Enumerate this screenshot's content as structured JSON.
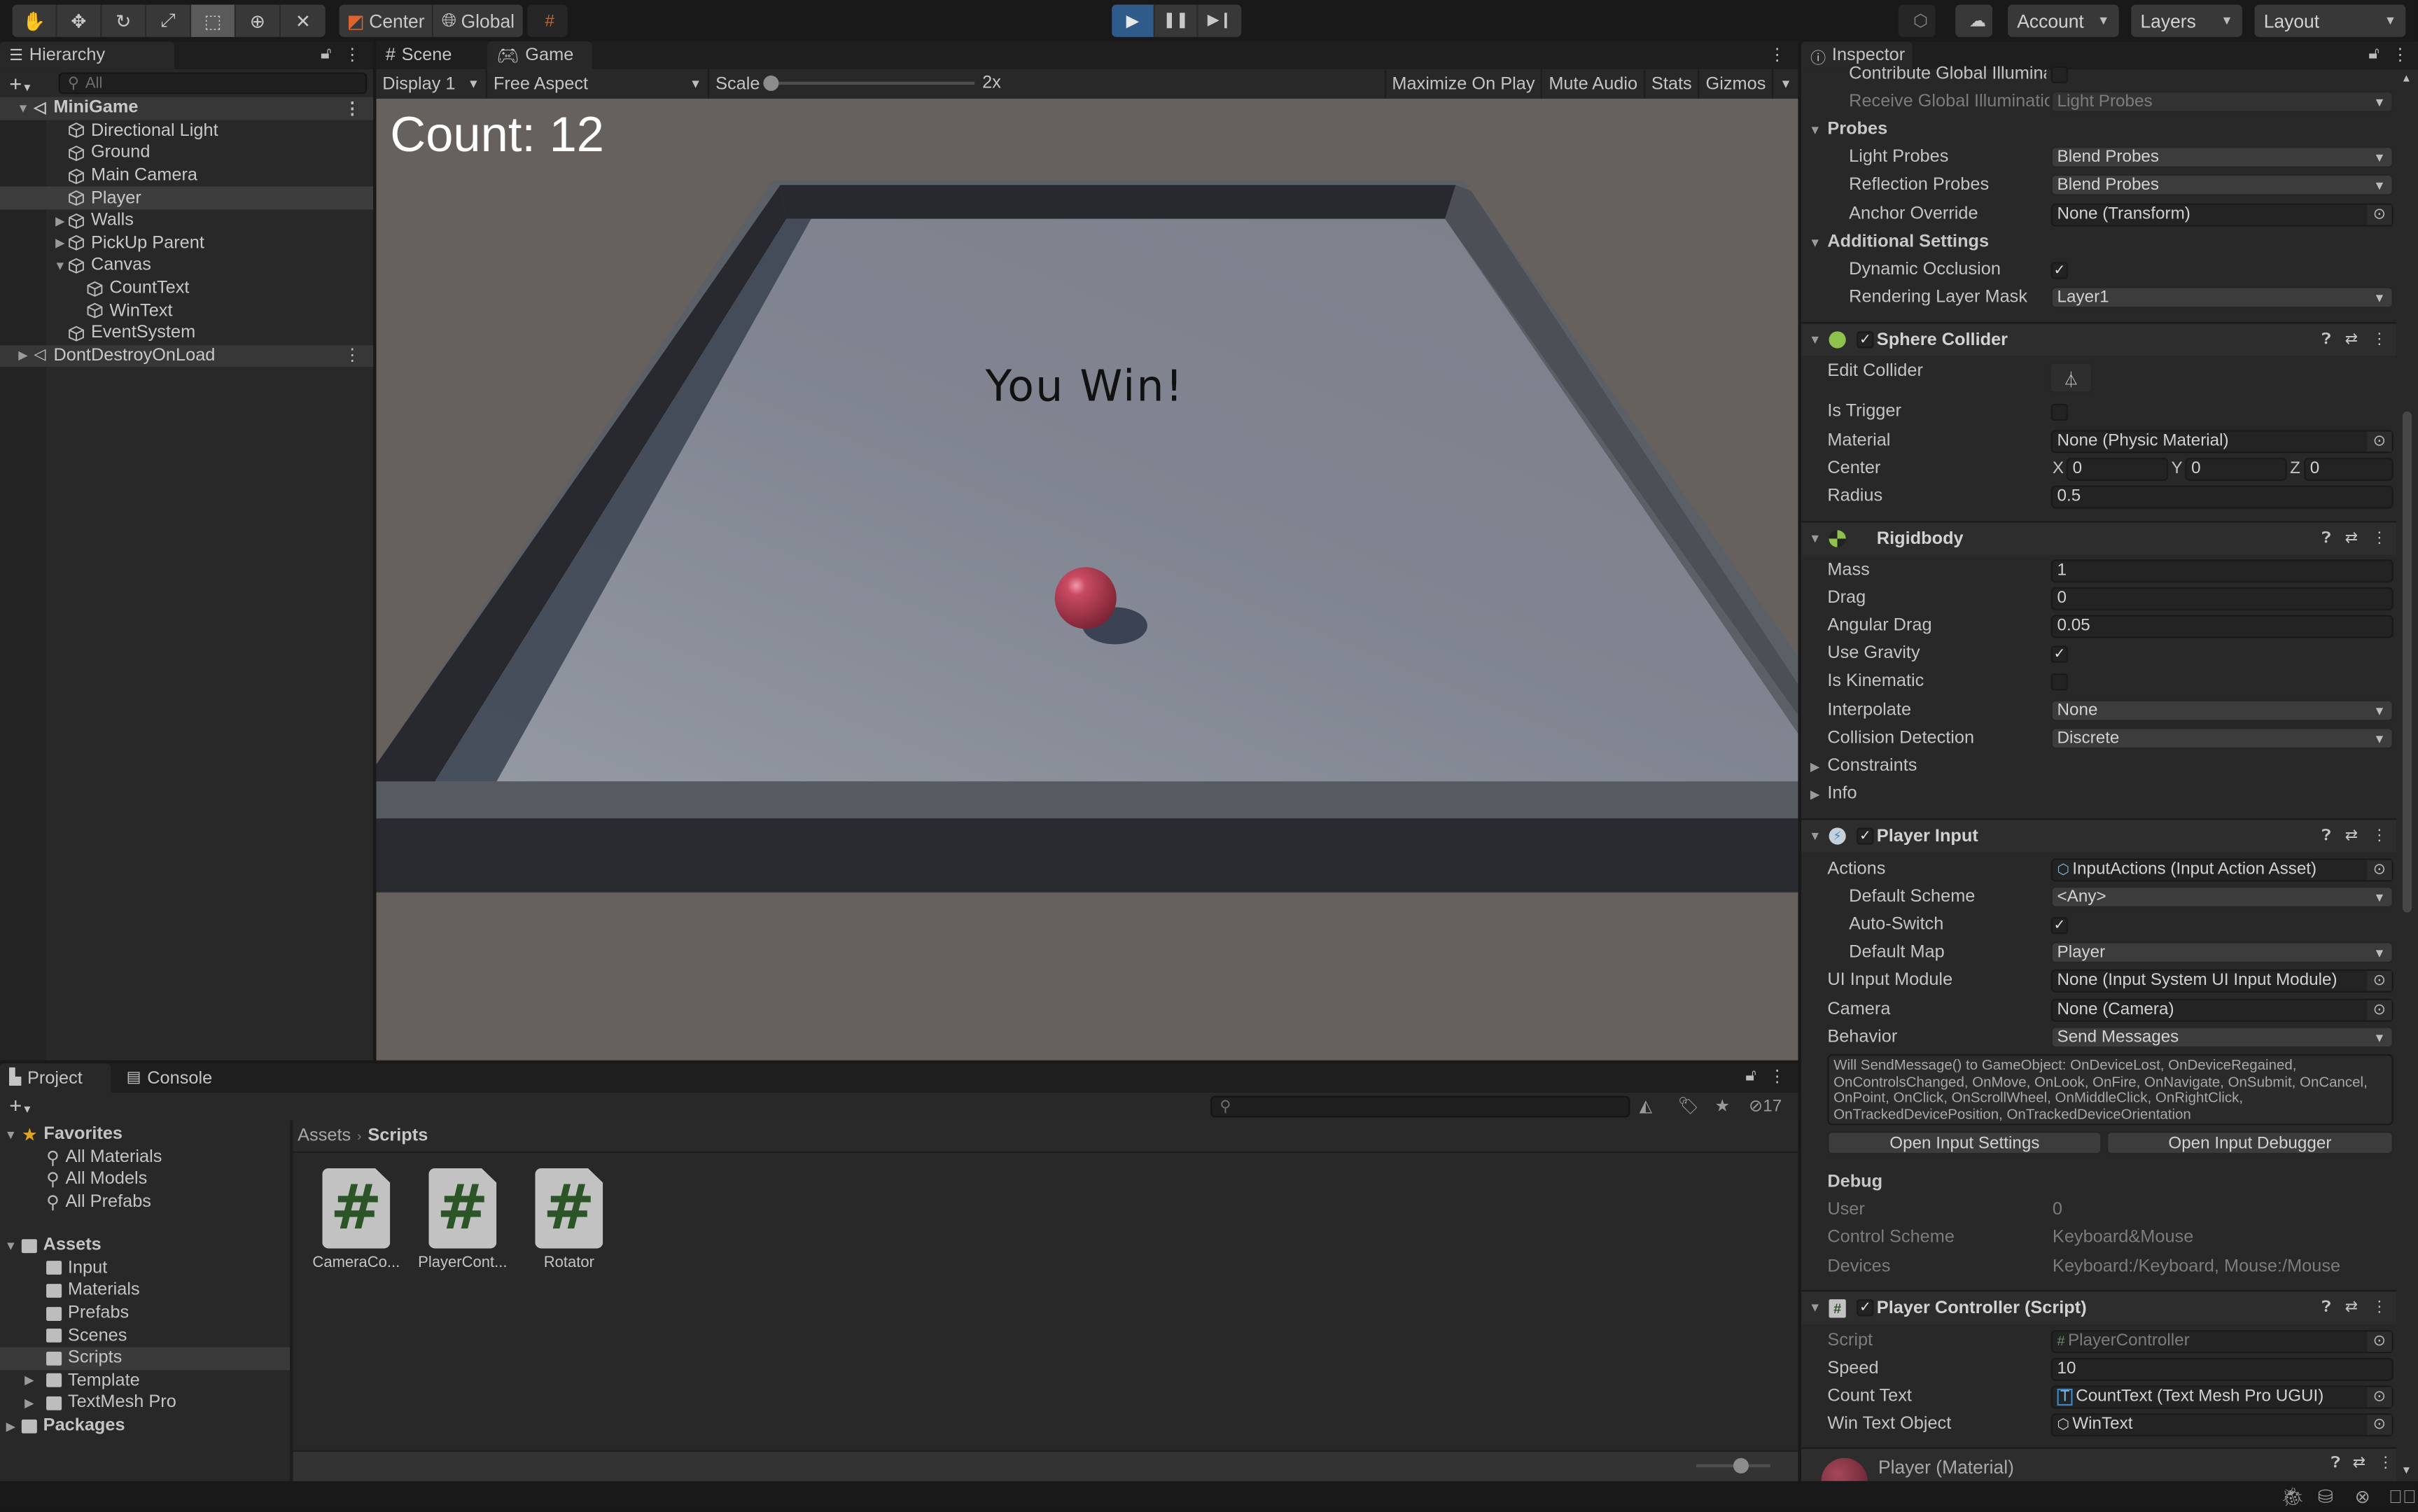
{
  "toolbar": {
    "tools": [
      "hand-tool",
      "move-tool",
      "rotate-tool",
      "scale-tool",
      "rect-tool",
      "transform-tool",
      "custom-tool"
    ],
    "active_tool": "rect-tool",
    "pivot_label": "Center",
    "space_label": "Global",
    "play_state": "playing",
    "account_label": "Account",
    "layers_label": "Layers",
    "layout_label": "Layout"
  },
  "hierarchy": {
    "tab_label": "Hierarchy",
    "search_placeholder": "All",
    "items": [
      {
        "label": "MiniGame",
        "type": "scene",
        "expanded": true
      },
      {
        "label": "Directional Light",
        "type": "object"
      },
      {
        "label": "Ground",
        "type": "object"
      },
      {
        "label": "Main Camera",
        "type": "object"
      },
      {
        "label": "Player",
        "type": "object",
        "selected": true
      },
      {
        "label": "Walls",
        "type": "object",
        "collapsed": true
      },
      {
        "label": "PickUp Parent",
        "type": "object",
        "collapsed": true
      },
      {
        "label": "Canvas",
        "type": "object",
        "expanded": true
      },
      {
        "label": "CountText",
        "type": "object"
      },
      {
        "label": "WinText",
        "type": "object"
      },
      {
        "label": "EventSystem",
        "type": "object"
      },
      {
        "label": "DontDestroyOnLoad",
        "type": "scene",
        "collapsed": true
      }
    ]
  },
  "game_view": {
    "tabs": [
      {
        "label": "Scene"
      },
      {
        "label": "Game",
        "active": true
      }
    ],
    "display": "Display 1",
    "aspect": "Free Aspect",
    "scale_label": "Scale",
    "scale_value": "2x",
    "maximize_on_play": "Maximize On Play",
    "mute_audio": "Mute Audio",
    "stats": "Stats",
    "gizmos": "Gizmos",
    "count_text": "Count: 12",
    "win_text": "You Win!"
  },
  "inspector": {
    "tab_label": "Inspector",
    "mesh_renderer": {
      "contribute_gi_label": "Contribute Global Illumina",
      "receive_gi_label": "Receive Global Illuminatio",
      "receive_gi_value": "Light Probes",
      "probes_header": "Probes",
      "light_probes_label": "Light Probes",
      "light_probes_value": "Blend Probes",
      "reflection_probes_label": "Reflection Probes",
      "reflection_probes_value": "Blend Probes",
      "anchor_override_label": "Anchor Override",
      "anchor_override_value": "None (Transform)",
      "additional_header": "Additional Settings",
      "dynamic_occlusion_label": "Dynamic Occlusion",
      "rendering_layer_mask_label": "Rendering Layer Mask",
      "rendering_layer_mask_value": "Layer1"
    },
    "sphere_collider": {
      "title": "Sphere Collider",
      "edit_collider_label": "Edit Collider",
      "is_trigger_label": "Is Trigger",
      "material_label": "Material",
      "material_value": "None (Physic Material)",
      "center_label": "Center",
      "center_x": "0",
      "center_y": "0",
      "center_z": "0",
      "radius_label": "Radius",
      "radius_value": "0.5"
    },
    "rigidbody": {
      "title": "Rigidbody",
      "mass_label": "Mass",
      "mass_value": "1",
      "drag_label": "Drag",
      "drag_value": "0",
      "angular_drag_label": "Angular Drag",
      "angular_drag_value": "0.05",
      "use_gravity_label": "Use Gravity",
      "is_kinematic_label": "Is Kinematic",
      "interpolate_label": "Interpolate",
      "interpolate_value": "None",
      "collision_label": "Collision Detection",
      "collision_value": "Discrete",
      "constraints_label": "Constraints",
      "info_label": "Info"
    },
    "player_input": {
      "title": "Player Input",
      "actions_label": "Actions",
      "actions_value": "InputActions (Input Action Asset)",
      "default_scheme_label": "Default Scheme",
      "default_scheme_value": "<Any>",
      "auto_switch_label": "Auto-Switch",
      "default_map_label": "Default Map",
      "default_map_value": "Player",
      "ui_input_label": "UI Input Module",
      "ui_input_value": "None (Input System UI Input Module)",
      "camera_label": "Camera",
      "camera_value": "None (Camera)",
      "behavior_label": "Behavior",
      "behavior_value": "Send Messages",
      "help_text": "Will SendMessage() to GameObject: OnDeviceLost, OnDeviceRegained, OnControlsChanged, OnMove, OnLook, OnFire, OnNavigate, OnSubmit, OnCancel, OnPoint, OnClick, OnScrollWheel, OnMiddleClick, OnRightClick, OnTrackedDevicePosition, OnTrackedDeviceOrientation",
      "open_settings": "Open Input Settings",
      "open_debugger": "Open Input Debugger",
      "debug_header": "Debug",
      "user_label": "User",
      "user_value": "0",
      "control_scheme_label": "Control Scheme",
      "control_scheme_value": "Keyboard&Mouse",
      "devices_label": "Devices",
      "devices_value": "Keyboard:/Keyboard, Mouse:/Mouse"
    },
    "player_controller": {
      "title": "Player Controller (Script)",
      "script_label": "Script",
      "script_value": "PlayerController",
      "speed_label": "Speed",
      "speed_value": "10",
      "count_text_label": "Count Text",
      "count_text_value": "CountText (Text Mesh Pro UGUI)",
      "win_text_label": "Win Text Object",
      "win_text_value": "WinText"
    },
    "material": {
      "title": "Player (Material)"
    }
  },
  "project": {
    "tabs": [
      {
        "label": "Project",
        "active": true
      },
      {
        "label": "Console"
      }
    ],
    "hidden_count": "17",
    "breadcrumb": [
      "Assets",
      "Scripts"
    ],
    "tree": [
      {
        "label": "Favorites",
        "kind": "header-star"
      },
      {
        "label": "All Materials",
        "kind": "search"
      },
      {
        "label": "All Models",
        "kind": "search"
      },
      {
        "label": "All Prefabs",
        "kind": "search"
      },
      {
        "label": "Assets",
        "kind": "header-folder"
      },
      {
        "label": "Input",
        "kind": "folder"
      },
      {
        "label": "Materials",
        "kind": "folder"
      },
      {
        "label": "Prefabs",
        "kind": "folder"
      },
      {
        "label": "Scenes",
        "kind": "folder"
      },
      {
        "label": "Scripts",
        "kind": "folder",
        "selected": true
      },
      {
        "label": "Template",
        "kind": "folder",
        "collapsed": true
      },
      {
        "label": "TextMesh Pro",
        "kind": "folder",
        "collapsed": true
      },
      {
        "label": "Packages",
        "kind": "header-folder",
        "collapsed": true
      }
    ],
    "assets": [
      {
        "label": "CameraCo..."
      },
      {
        "label": "PlayerCont..."
      },
      {
        "label": "Rotator"
      }
    ],
    "zoom_slider": 0.6
  },
  "colors": {
    "accent_play": "#2f5b8a",
    "script_green": "#2b5427",
    "favorite_star": "#e0a526",
    "player_sphere": "#c24055"
  }
}
